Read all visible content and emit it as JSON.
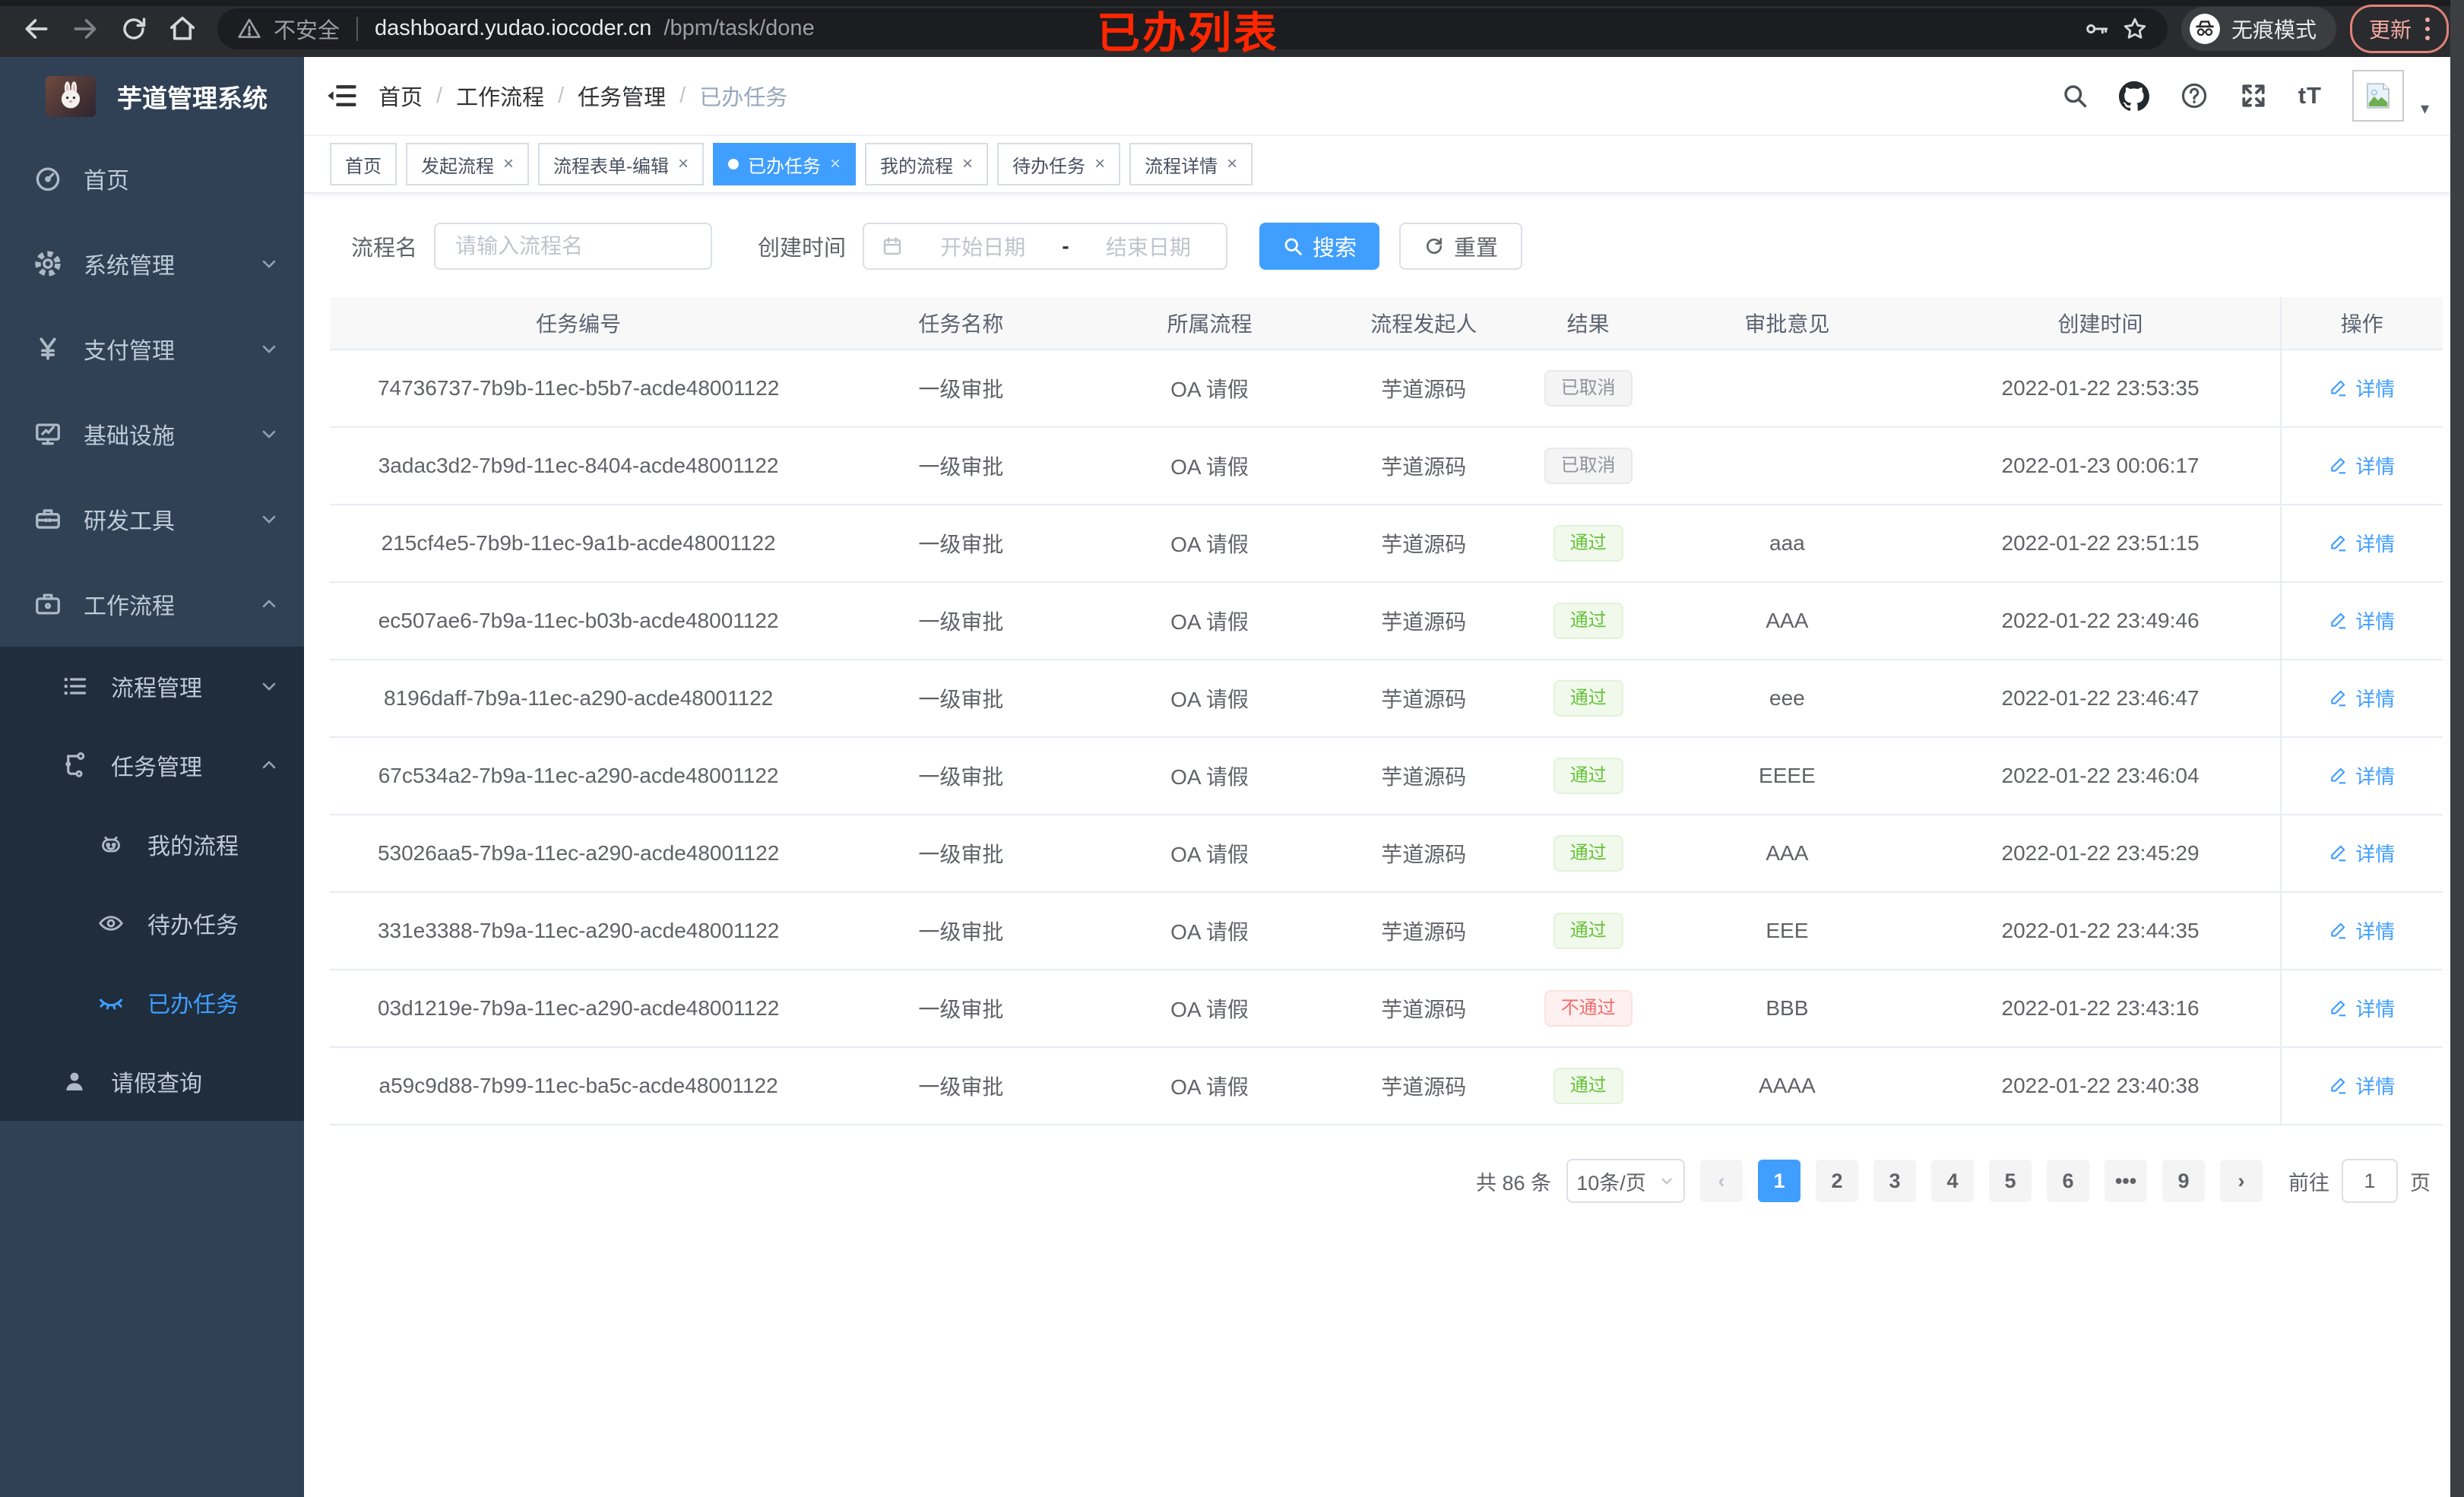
{
  "annotation": {
    "label": "已办列表"
  },
  "browser": {
    "security_label": "不安全",
    "url_host": "dashboard.yudao.iocoder.cn",
    "url_path": "/bpm/task/done",
    "incognito_label": "无痕模式",
    "update_label": "更新"
  },
  "sidebar": {
    "app_title": "芋道管理系统",
    "menu": [
      {
        "label": "首页"
      },
      {
        "label": "系统管理"
      },
      {
        "label": "支付管理"
      },
      {
        "label": "基础设施"
      },
      {
        "label": "研发工具"
      },
      {
        "label": "工作流程"
      }
    ],
    "workflow_children": [
      {
        "label": "流程管理"
      },
      {
        "label": "任务管理"
      }
    ],
    "task_children": [
      {
        "label": "我的流程"
      },
      {
        "label": "待办任务"
      },
      {
        "label": "已办任务"
      }
    ],
    "leave_query_label": "请假查询"
  },
  "navbar": {
    "breadcrumb": [
      "首页",
      "工作流程",
      "任务管理",
      "已办任务"
    ],
    "separator": "/",
    "font_size_icon_text": "tT",
    "avatar_caret": "▾"
  },
  "tabs": {
    "close_glyph": "×",
    "items": [
      {
        "label": "首页"
      },
      {
        "label": "发起流程"
      },
      {
        "label": "流程表单-编辑"
      },
      {
        "label": "已办任务"
      },
      {
        "label": "我的流程"
      },
      {
        "label": "待办任务"
      },
      {
        "label": "流程详情"
      }
    ]
  },
  "search": {
    "name_label": "流程名",
    "name_placeholder": "请输入流程名",
    "time_label": "创建时间",
    "start_placeholder": "开始日期",
    "range_separator": "-",
    "end_placeholder": "结束日期",
    "search_label": "搜索",
    "reset_label": "重置"
  },
  "table": {
    "headers": [
      "任务编号",
      "任务名称",
      "所属流程",
      "流程发起人",
      "结果",
      "审批意见",
      "创建时间",
      "操作"
    ],
    "detail_label": "详情",
    "rows": [
      {
        "task_id": "74736737-7b9b-11ec-b5b7-acde48001122",
        "task_name": "一级审批",
        "process": "OA 请假",
        "initiator": "芋道源码",
        "result": "已取消",
        "result_type": "info",
        "comment": "",
        "created_at": "2022-01-22 23:53:35"
      },
      {
        "task_id": "3adac3d2-7b9d-11ec-8404-acde48001122",
        "task_name": "一级审批",
        "process": "OA 请假",
        "initiator": "芋道源码",
        "result": "已取消",
        "result_type": "info",
        "comment": "",
        "created_at": "2022-01-23 00:06:17"
      },
      {
        "task_id": "215cf4e5-7b9b-11ec-9a1b-acde48001122",
        "task_name": "一级审批",
        "process": "OA 请假",
        "initiator": "芋道源码",
        "result": "通过",
        "result_type": "success",
        "comment": "aaa",
        "created_at": "2022-01-22 23:51:15"
      },
      {
        "task_id": "ec507ae6-7b9a-11ec-b03b-acde48001122",
        "task_name": "一级审批",
        "process": "OA 请假",
        "initiator": "芋道源码",
        "result": "通过",
        "result_type": "success",
        "comment": "AAA",
        "created_at": "2022-01-22 23:49:46"
      },
      {
        "task_id": "8196daff-7b9a-11ec-a290-acde48001122",
        "task_name": "一级审批",
        "process": "OA 请假",
        "initiator": "芋道源码",
        "result": "通过",
        "result_type": "success",
        "comment": "eee",
        "created_at": "2022-01-22 23:46:47"
      },
      {
        "task_id": "67c534a2-7b9a-11ec-a290-acde48001122",
        "task_name": "一级审批",
        "process": "OA 请假",
        "initiator": "芋道源码",
        "result": "通过",
        "result_type": "success",
        "comment": "EEEE",
        "created_at": "2022-01-22 23:46:04"
      },
      {
        "task_id": "53026aa5-7b9a-11ec-a290-acde48001122",
        "task_name": "一级审批",
        "process": "OA 请假",
        "initiator": "芋道源码",
        "result": "通过",
        "result_type": "success",
        "comment": "AAA",
        "created_at": "2022-01-22 23:45:29"
      },
      {
        "task_id": "331e3388-7b9a-11ec-a290-acde48001122",
        "task_name": "一级审批",
        "process": "OA 请假",
        "initiator": "芋道源码",
        "result": "通过",
        "result_type": "success",
        "comment": "EEE",
        "created_at": "2022-01-22 23:44:35"
      },
      {
        "task_id": "03d1219e-7b9a-11ec-a290-acde48001122",
        "task_name": "一级审批",
        "process": "OA 请假",
        "initiator": "芋道源码",
        "result": "不通过",
        "result_type": "danger",
        "comment": "BBB",
        "created_at": "2022-01-22 23:43:16"
      },
      {
        "task_id": "a59c9d88-7b99-11ec-ba5c-acde48001122",
        "task_name": "一级审批",
        "process": "OA 请假",
        "initiator": "芋道源码",
        "result": "通过",
        "result_type": "success",
        "comment": "AAAA",
        "created_at": "2022-01-22 23:40:38"
      }
    ]
  },
  "pagination": {
    "total_label": "共 86 条",
    "page_size_label": "10条/页",
    "prev_glyph": "‹",
    "next_glyph": "›",
    "pages": [
      "1",
      "2",
      "3",
      "4",
      "5",
      "6",
      "•••",
      "9"
    ],
    "goto_label": "前往",
    "goto_value": "1",
    "page_unit_label": "页"
  }
}
